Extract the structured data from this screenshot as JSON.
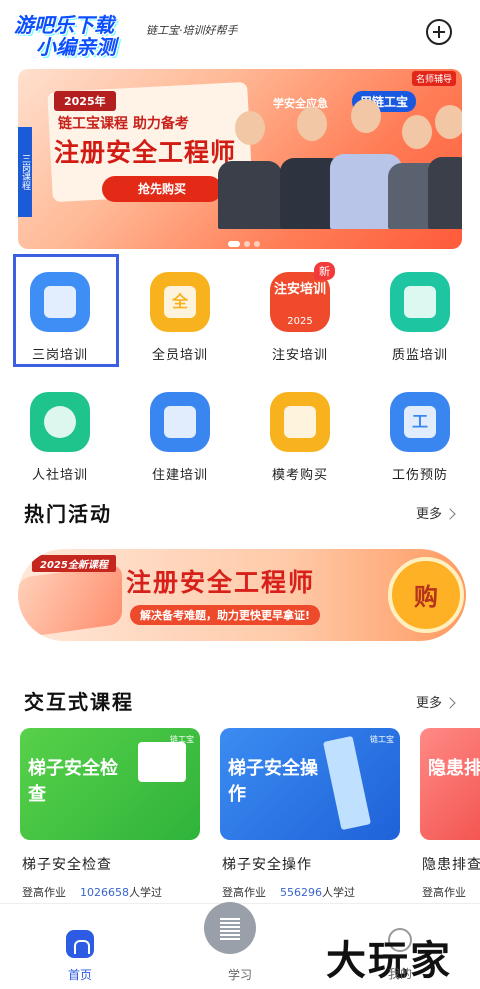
{
  "header": {
    "watermark_line1": "游吧乐下载",
    "watermark_line2": "小编亲测",
    "slogan": "链工宝·培训好帮手"
  },
  "banner": {
    "side_text": "三岗课程",
    "year": "2025年",
    "line1": "链工宝课程 助力备考",
    "line2": "注册安全工程师",
    "buy_label": "抢先购买",
    "tag": "学安全应急",
    "tag2": "用链工宝",
    "corner": "名师辅导"
  },
  "grid": {
    "items": [
      {
        "label": "三岗培训",
        "icon": "document-icon",
        "color": "#3e8ef5"
      },
      {
        "label": "全员培训",
        "icon": "badge-icon",
        "color": "#f7b21d",
        "glyph": "全"
      },
      {
        "label": "注安培训",
        "icon": "book-icon",
        "color": "#f04a2c",
        "glyph": "注安培训",
        "badge": "新",
        "year": "2025"
      },
      {
        "label": "质监培训",
        "icon": "shield-check-icon",
        "color": "#1dc6a0"
      },
      {
        "label": "人社培训",
        "icon": "person-icon",
        "color": "#1fc38c"
      },
      {
        "label": "住建培训",
        "icon": "building-icon",
        "color": "#3a86f0"
      },
      {
        "label": "模考购买",
        "icon": "shopping-bag-icon",
        "color": "#f7b21d"
      },
      {
        "label": "工伤预防",
        "icon": "work-injury-icon",
        "color": "#3a86f0",
        "glyph": "工"
      }
    ]
  },
  "hot": {
    "title": "热门活动",
    "more": "更多",
    "tag": "2025全新课程",
    "activity_title": "注册安全工程师",
    "activity_sub": "解决备考难题，助力更快更早拿证!",
    "buy": "购"
  },
  "courses": {
    "title": "交互式课程",
    "more": "更多",
    "brand": "链工宝",
    "items": [
      {
        "card_title": "梯子安全检查",
        "caption": "梯子安全检查",
        "meta_prefix": "登高作业",
        "count": "1026658",
        "meta_suffix": "人学过"
      },
      {
        "card_title": "梯子安全操作",
        "caption": "梯子安全操作",
        "meta_prefix": "登高作业",
        "count": "556296",
        "meta_suffix": "人学过"
      },
      {
        "card_title": "隐患排查",
        "caption": "隐患排查",
        "meta_prefix": "登高作业",
        "count": "",
        "meta_suffix": ""
      }
    ]
  },
  "nav": {
    "home": "首页",
    "study": "学习",
    "mine": "我的",
    "brand_mark": "大玩家"
  }
}
